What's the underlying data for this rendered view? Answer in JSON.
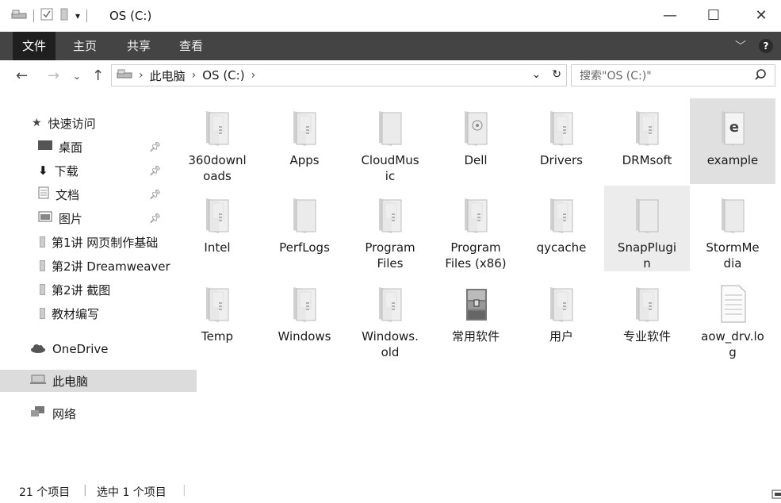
{
  "window": {
    "title": "OS (C:)",
    "minimize": "—",
    "maximize": "☐",
    "close": "✕"
  },
  "ribbon": {
    "tabs": [
      {
        "label": "文件"
      },
      {
        "label": "主页"
      },
      {
        "label": "共享"
      },
      {
        "label": "查看"
      }
    ]
  },
  "address": {
    "crumbs": [
      "此电脑",
      "OS (C:)"
    ],
    "search_placeholder": "搜索\"OS (C:)\""
  },
  "sidebar": {
    "quick_access": "快速访问",
    "items": [
      {
        "label": "桌面",
        "icon": "desktop-icon",
        "pinned": true
      },
      {
        "label": "下载",
        "icon": "download-icon",
        "pinned": true
      },
      {
        "label": "文档",
        "icon": "documents-icon",
        "pinned": true
      },
      {
        "label": "图片",
        "icon": "pictures-icon",
        "pinned": true
      },
      {
        "label": "第1讲 网页制作基础",
        "icon": "folder-icon",
        "pinned": false
      },
      {
        "label": "第2讲 Dreamweaver",
        "icon": "folder-icon",
        "pinned": false
      },
      {
        "label": "第2讲 截图",
        "icon": "folder-icon",
        "pinned": false
      },
      {
        "label": "教材编写",
        "icon": "folder-icon",
        "pinned": false
      }
    ],
    "onedrive": "OneDrive",
    "this_pc": "此电脑",
    "network": "网络"
  },
  "files": [
    {
      "name": "360downloads",
      "label": "360downl\noads",
      "type": "folder-doc"
    },
    {
      "name": "Apps",
      "label": "Apps",
      "type": "folder-doc"
    },
    {
      "name": "CloudMusic",
      "label": "CloudMus\nic",
      "type": "folder"
    },
    {
      "name": "Dell",
      "label": "Dell",
      "type": "folder-media"
    },
    {
      "name": "Drivers",
      "label": "Drivers",
      "type": "folder-doc"
    },
    {
      "name": "DRMsoft",
      "label": "DRMsoft",
      "type": "folder-doc"
    },
    {
      "name": "example",
      "label": "example",
      "type": "folder-edge",
      "state": "selected"
    },
    {
      "name": "Intel",
      "label": "Intel",
      "type": "folder-doc"
    },
    {
      "name": "PerfLogs",
      "label": "PerfLogs",
      "type": "folder"
    },
    {
      "name": "Program Files",
      "label": "Program\nFiles",
      "type": "folder-doc"
    },
    {
      "name": "Program Files (x86)",
      "label": "Program\nFiles (x86)",
      "type": "folder-doc"
    },
    {
      "name": "qycache",
      "label": "qycache",
      "type": "folder-doc"
    },
    {
      "name": "SnapPlugin",
      "label": "SnapPlugi\nn",
      "type": "folder",
      "state": "hover"
    },
    {
      "name": "StormMedia",
      "label": "StormMe\ndia",
      "type": "folder"
    },
    {
      "name": "Temp",
      "label": "Temp",
      "type": "folder-doc"
    },
    {
      "name": "Windows",
      "label": "Windows",
      "type": "folder-doc"
    },
    {
      "name": "Windows.old",
      "label": "Windows.\nold",
      "type": "folder-doc"
    },
    {
      "name": "常用软件",
      "label": "常用软件",
      "type": "archive"
    },
    {
      "name": "用户",
      "label": "用户",
      "type": "folder-doc"
    },
    {
      "name": "专业软件",
      "label": "专业软件",
      "type": "folder-doc"
    },
    {
      "name": "aow_drv.log",
      "label": "aow_drv.lo\ng",
      "type": "text-file"
    }
  ],
  "status": {
    "count": "21 个项目",
    "selected": "选中 1 个项目"
  }
}
